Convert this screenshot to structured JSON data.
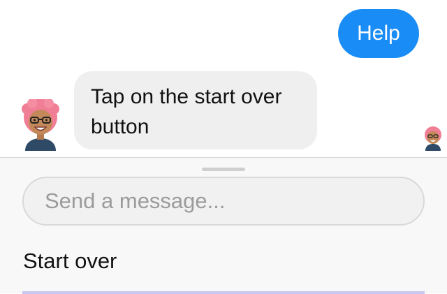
{
  "conversation": {
    "user_message": "Help",
    "bot_message": "Tap on the start over button",
    "bot_avatar_icon": "cartoon-avatar-pink-hair-glasses",
    "read_receipt_icon": "small-bot-avatar"
  },
  "composer": {
    "placeholder": "Send a message...",
    "value": "",
    "quick_reply": "Start over"
  },
  "colors": {
    "user_bubble": "#1a8cf5",
    "bot_bubble": "#efefef",
    "composer_background": "#f8f8f8",
    "avatar_hair": "#f07f95",
    "avatar_shirt": "#2e4a66"
  }
}
